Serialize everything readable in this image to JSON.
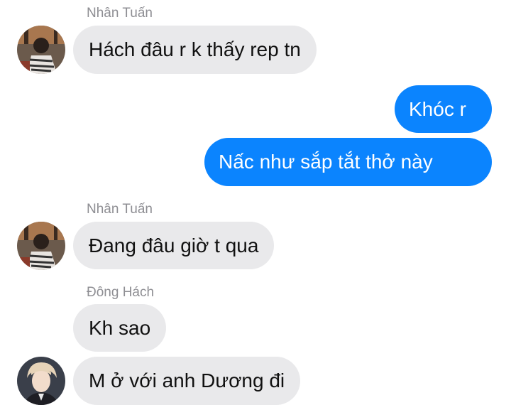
{
  "messages": [
    {
      "sender": "Nhân Tuấn",
      "text": "Hách đâu r k thấy rep tn",
      "avatar_icon": "friend-avatar-photo"
    },
    {
      "text": "Khóc r"
    },
    {
      "text": "Nấc như sắp tắt thở này"
    },
    {
      "sender": "Nhân Tuấn",
      "text": "Đang đâu giờ t qua",
      "avatar_icon": "friend-avatar-photo"
    },
    {
      "sender": "Đông Hách",
      "text": "Kh sao"
    },
    {
      "text": "M ở với anh Dương đi",
      "avatar_icon": "friend-avatar-photo"
    }
  ],
  "colors": {
    "outgoing_bubble": "#0b84fe",
    "incoming_bubble": "#e9e9eb",
    "sender_name": "#8e8e93"
  }
}
